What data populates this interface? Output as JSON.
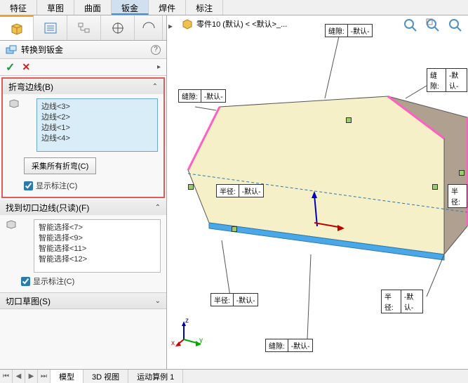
{
  "menubar": {
    "items": [
      "特征",
      "草图",
      "曲面",
      "钣金",
      "焊件",
      "标注"
    ],
    "active": 3
  },
  "panel": {
    "title": "转换到钣金",
    "ok_aria": "确定",
    "cancel_aria": "取消",
    "group1": {
      "header": "折弯边线(B)",
      "items": [
        "边线<3>",
        "边线<2>",
        "边线<1>",
        "边线<4>"
      ],
      "button": "采集所有折弯(C)",
      "checkbox": "显示标注(C)"
    },
    "group2": {
      "header": "找到切口边线(只读)(F)",
      "items": [
        "智能选择<7>",
        "智能选择<9>",
        "智能选择<11>",
        "智能选择<12>"
      ],
      "checkbox": "显示标注(C)"
    },
    "group3": {
      "header": "切口草图(S)"
    }
  },
  "viewport": {
    "breadcrumb": "零件10 (默认) < <默认>_...",
    "callouts": {
      "gap_label": "缝隙:",
      "radius_label": "半径:",
      "default_label": "-默认-"
    },
    "triad": {
      "z": "z",
      "y": "y",
      "x": "x"
    }
  },
  "bottomtabs": {
    "items": [
      "模型",
      "3D 视图",
      "运动算例 1"
    ],
    "active": 0
  }
}
